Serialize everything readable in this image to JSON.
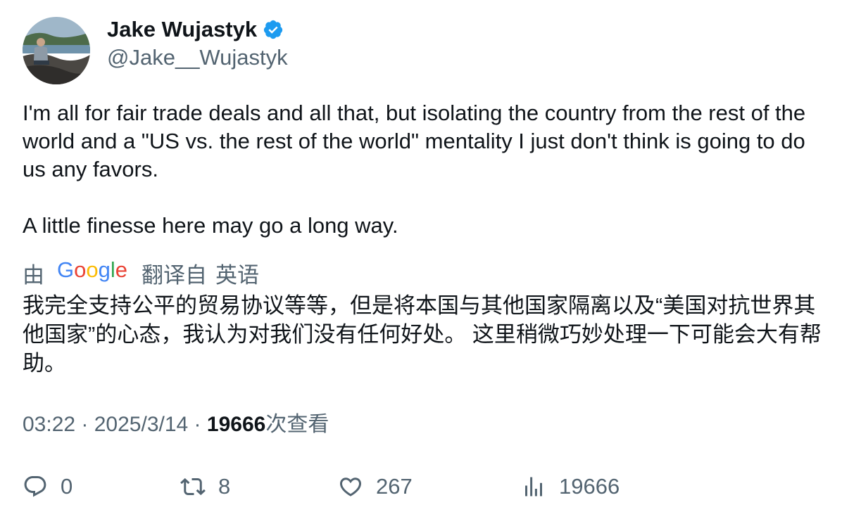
{
  "author": {
    "display_name": "Jake Wujastyk",
    "handle": "@Jake__Wujastyk",
    "verified": true,
    "avatar_icon": "user-avatar-photo"
  },
  "tweet": {
    "paragraph_1": "I'm all for fair trade deals and all that, but isolating the country from the rest of the world and a \"US vs. the rest of the world\" mentality I just don't think is going to do us any favors.",
    "paragraph_2": "A little finesse here may go a long way."
  },
  "translation": {
    "by_prefix": "由",
    "provider": "Google",
    "translated_from": "翻译自",
    "source_language": "英语",
    "text": "我完全支持公平的贸易协议等等，但是将本国与其他国家隔离以及“美国对抗世界其他国家”的心态，我认为对我们没有任何好处。 这里稍微巧妙处理一下可能会大有帮助。"
  },
  "meta": {
    "time": "03:22",
    "separator": " · ",
    "date": "2025/3/14",
    "views": "19666",
    "views_label": "次查看"
  },
  "actions": {
    "replies": "0",
    "retweets": "8",
    "likes": "267",
    "views": "19666"
  },
  "colors": {
    "text_primary": "#0f1419",
    "text_secondary": "#536471",
    "verified_blue": "#1d9bf0",
    "google_blue": "#4285f4",
    "google_red": "#ea4335",
    "google_yellow": "#fbbc05",
    "google_green": "#34a853"
  }
}
